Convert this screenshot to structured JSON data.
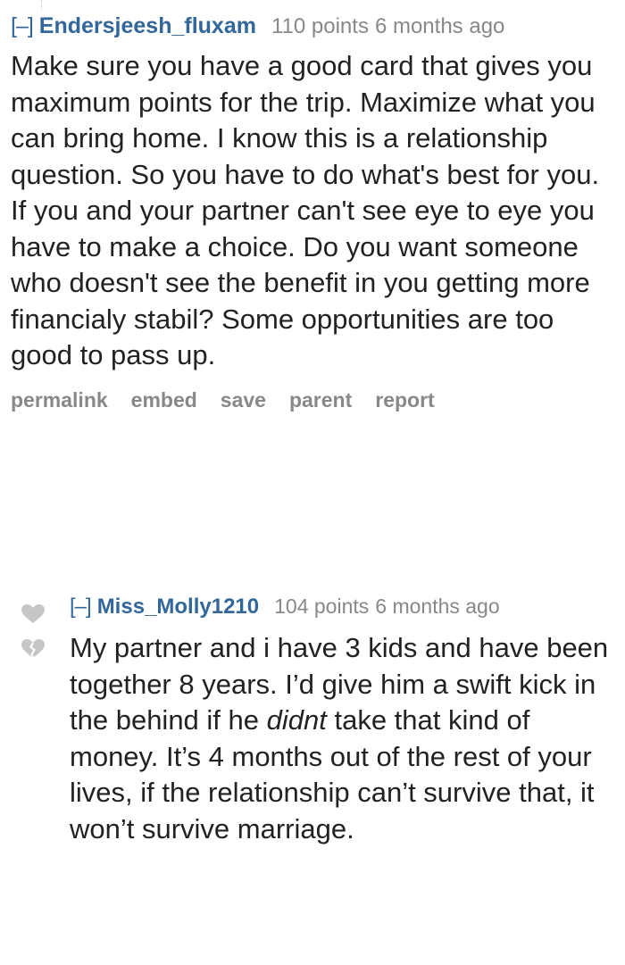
{
  "comments": [
    {
      "collapse_label": "[–]",
      "author": "Endersjeesh_fluxam",
      "score": "110 points",
      "time": "6 months ago",
      "body": "Make sure you have a good card that gives you maximum points for the trip. Maximize what you can bring home. I know this is a relationship question. So you have to do what's best for you. If you and your partner can't see eye to eye you have to make a choice. Do you want someone who doesn't see the benefit in you getting more financialy stabil? Some opportunities are too good to pass up.",
      "buttons": {
        "permalink": "permalink",
        "embed": "embed",
        "save": "save",
        "parent": "parent",
        "report": "report"
      }
    },
    {
      "collapse_label": "[–]",
      "author": "Miss_Molly1210",
      "score": "104 points",
      "time": "6 months ago",
      "body_parts": [
        "My partner and i have 3 kids and have been together 8 years. I’d give him a swift kick in the behind if he ",
        "didnt",
        " take that kind of money. It’s 4 months out of the rest of your lives, if the relationship can’t survive that, it won’t survive marriage."
      ],
      "vote_icons": [
        "upvote-heart-icon",
        "downvote-broken-heart-icon"
      ]
    }
  ],
  "colors": {
    "author_link": "#336699",
    "meta_gray": "#888888",
    "body_text": "#222222",
    "vote_icon": "#c6c6c6"
  }
}
